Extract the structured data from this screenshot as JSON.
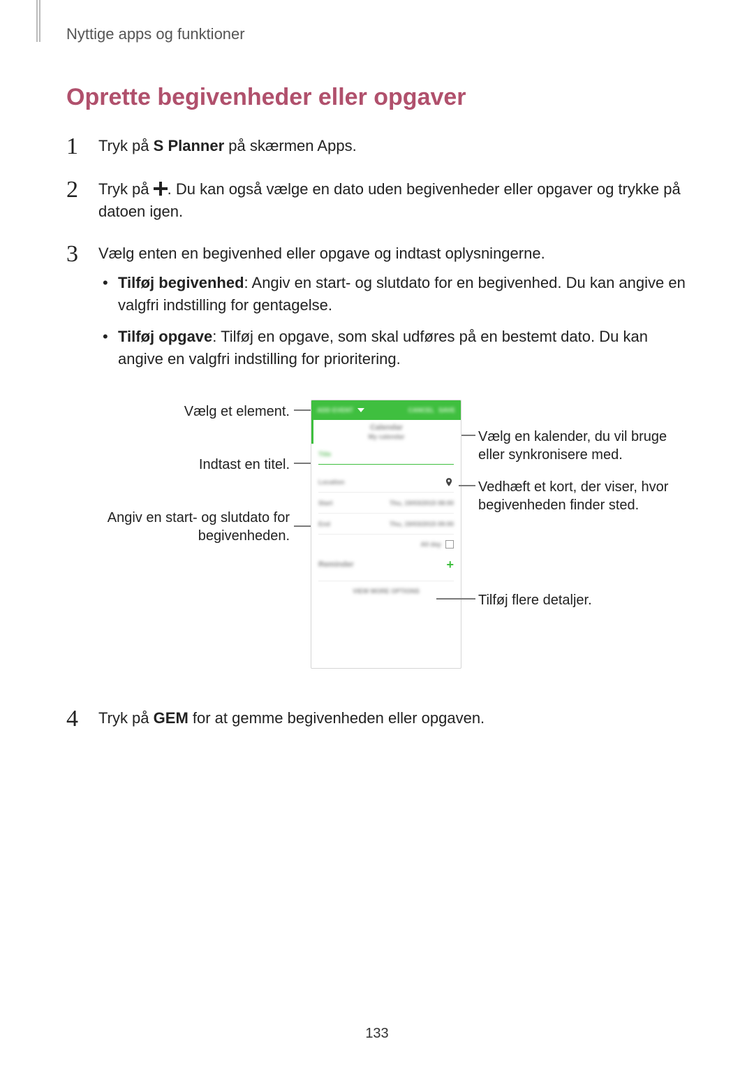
{
  "header": "Nyttige apps og funktioner",
  "section_title": "Oprette begivenheder eller opgaver",
  "steps": {
    "s1": {
      "num": "1",
      "pre": "Tryk på ",
      "bold": "S Planner",
      "post": " på skærmen Apps."
    },
    "s2a": {
      "num": "2",
      "pre": "Tryk på ",
      "post1": ". Du kan også vælge en dato uden begivenheder eller opgaver og trykke på datoen igen."
    },
    "s3": {
      "num": "3",
      "text": "Vælg enten en begivenhed eller opgave og indtast oplysningerne."
    },
    "b1_bold": "Tilføj begivenhed",
    "b1_text": ": Angiv en start- og slutdato for en begivenhed. Du kan angive en valgfri indstilling for gentagelse.",
    "b2_bold": "Tilføj opgave",
    "b2_text": ": Tilføj en opgave, som skal udføres på en bestemt dato. Du kan angive en valgfri indstilling for prioritering.",
    "s4": {
      "num": "4",
      "pre": "Tryk på ",
      "bold": "GEM",
      "post": " for at gemme begivenheden eller opgaven."
    }
  },
  "callouts": {
    "c1": "Vælg et element.",
    "c2": "Indtast en titel.",
    "c3": "Angiv en start- og slutdato for begivenheden.",
    "c4": "Vælg en kalender, du vil bruge eller synkronisere med.",
    "c5": "Vedhæft et kort, der viser, hvor begivenheden finder sted.",
    "c6": "Tilføj flere detaljer."
  },
  "phone": {
    "topbar_addevent": "ADD EVENT",
    "topbar_cancel": "CANCEL",
    "topbar_save": "SAVE",
    "calendar": "Calendar",
    "myaccount": "My calendar",
    "title": "Title",
    "location": "Location",
    "start": "Start",
    "end": "End",
    "date1": "Thu, 19/03/2015   08:00",
    "date2": "Thu, 19/03/2015   09:00",
    "allday": "All day",
    "reminder": "Reminder",
    "more": "VIEW MORE OPTIONS"
  },
  "page_number": "133"
}
